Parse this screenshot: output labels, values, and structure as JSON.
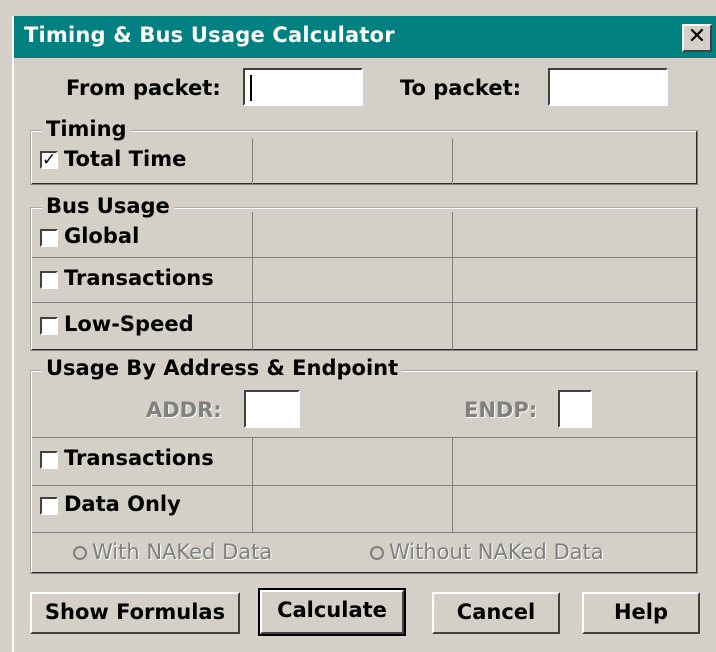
{
  "window": {
    "title": "Timing & Bus Usage Calculator",
    "close_glyph": "✕"
  },
  "range": {
    "from_label": "From packet:",
    "from_value": "",
    "to_label": "To packet:",
    "to_value": ""
  },
  "timing": {
    "legend": "Timing",
    "items": [
      {
        "label": "Total Time",
        "checked": true,
        "mark": "✓"
      }
    ]
  },
  "bus_usage": {
    "legend": "Bus Usage",
    "items": [
      {
        "label": "Global",
        "checked": false
      },
      {
        "label": "Transactions",
        "checked": false
      },
      {
        "label": "Low-Speed",
        "checked": false
      }
    ]
  },
  "address_usage": {
    "legend": "Usage By Address & Endpoint",
    "addr_label": "ADDR:",
    "addr_value": "",
    "endp_label": "ENDP:",
    "endp_value": "",
    "items": [
      {
        "label": "Transactions",
        "checked": false
      },
      {
        "label": "Data Only",
        "checked": false
      }
    ],
    "radios": [
      {
        "label": "With NAKed Data",
        "selected": false,
        "enabled": false
      },
      {
        "label": "Without NAKed Data",
        "selected": false,
        "enabled": false
      }
    ]
  },
  "buttons": {
    "show_formulas": "Show Formulas",
    "calculate": "Calculate",
    "cancel": "Cancel",
    "help": "Help"
  },
  "colors": {
    "titlebar": "#008080",
    "face": "#d4d0c8",
    "disabled_text": "#808080"
  }
}
